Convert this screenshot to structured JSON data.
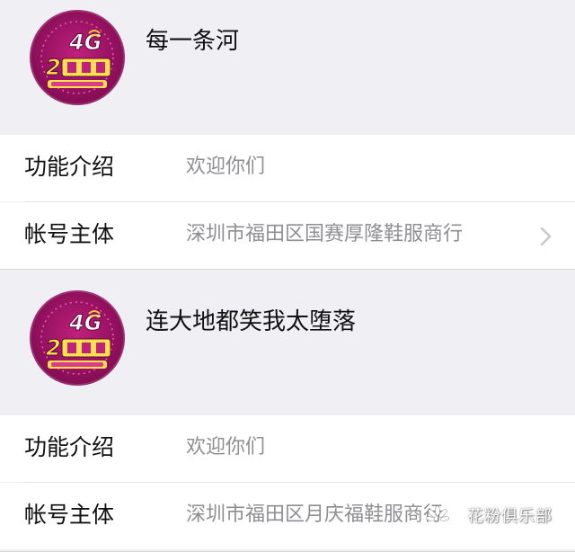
{
  "accounts": [
    {
      "name": "每一条河",
      "avatar_logo": "4G 2周年",
      "intro_label": "功能介绍",
      "intro_value": "欢迎你们",
      "entity_label": "帐号主体",
      "entity_value": "深圳市福田区国赛厚隆鞋服商行",
      "has_chevron": true
    },
    {
      "name": "连大地都笑我太堕落",
      "avatar_logo": "4G 2周年",
      "intro_label": "功能介绍",
      "intro_value": "欢迎你们",
      "entity_label": "帐号主体",
      "entity_value": "深圳市福田区月庆福鞋服商行",
      "has_chevron": false
    }
  ],
  "watermark": {
    "text": "花粉俱乐部",
    "icon": "huawei-flower-icon"
  },
  "colors": {
    "background": "#efeff4",
    "row_background": "#ffffff",
    "label_text": "#111111",
    "value_text": "#8e8e93",
    "avatar_magenta": "#a3156b"
  }
}
